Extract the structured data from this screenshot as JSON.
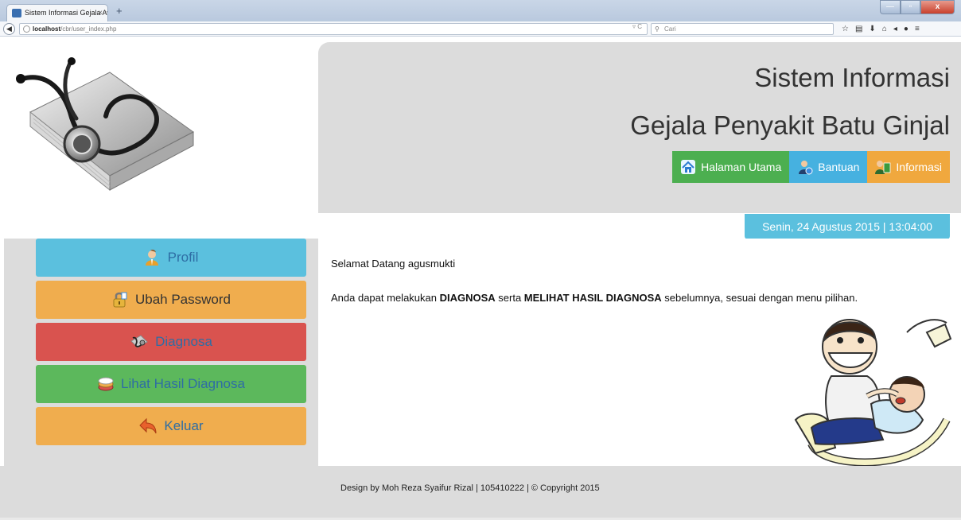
{
  "browser": {
    "tab_title": "Sistem Informasi Gejala Aw...",
    "tab_close": "×",
    "new_tab": "+",
    "url_host": "localhost",
    "url_path": "/cbr/user_index.php",
    "reload": "▿ C",
    "search_placeholder": "Cari",
    "window_buttons": {
      "minimize": "—",
      "maximize": "▫",
      "close": "x"
    }
  },
  "header": {
    "title_line1": "Sistem Informasi",
    "title_line2": "Gejala Penyakit Batu Ginjal",
    "nav": [
      {
        "label": "Halaman Utama",
        "icon": "home-icon"
      },
      {
        "label": "Bantuan",
        "icon": "help-user-icon"
      },
      {
        "label": "Informasi",
        "icon": "info-book-icon"
      }
    ],
    "datetime": "Senin, 24 Agustus 2015   |   13:04:00"
  },
  "sidebar": {
    "items": [
      {
        "label": "Profil",
        "icon": "user-profile-icon",
        "bg": "#5bc0de",
        "color": "#2e6da4"
      },
      {
        "label": "Ubah Password",
        "icon": "lock-icon",
        "bg": "#f0ad4e",
        "color": "#333333"
      },
      {
        "label": "Diagnosa",
        "icon": "stethoscope-icon",
        "bg": "#d9534f",
        "color": "#2e6da4"
      },
      {
        "label": "Lihat Hasil Diagnosa",
        "icon": "pills-icon",
        "bg": "#5cb85c",
        "color": "#2e6da4"
      },
      {
        "label": "Keluar",
        "icon": "logout-arrow-icon",
        "bg": "#f0ad4e",
        "color": "#2e6da4"
      }
    ]
  },
  "content": {
    "welcome": "Selamat Datang agusmukti",
    "info_prefix": "Anda dapat melakukan ",
    "info_bold1": "DIAGNOSA",
    "info_mid": " serta ",
    "info_bold2": "MELIHAT HASIL DIAGNOSA",
    "info_suffix": " sebelumnya, sesuai dengan menu pilihan."
  },
  "footer": {
    "text": "Design by Moh Reza Syaifur Rizal | 105410222 | © Copyright 2015"
  }
}
